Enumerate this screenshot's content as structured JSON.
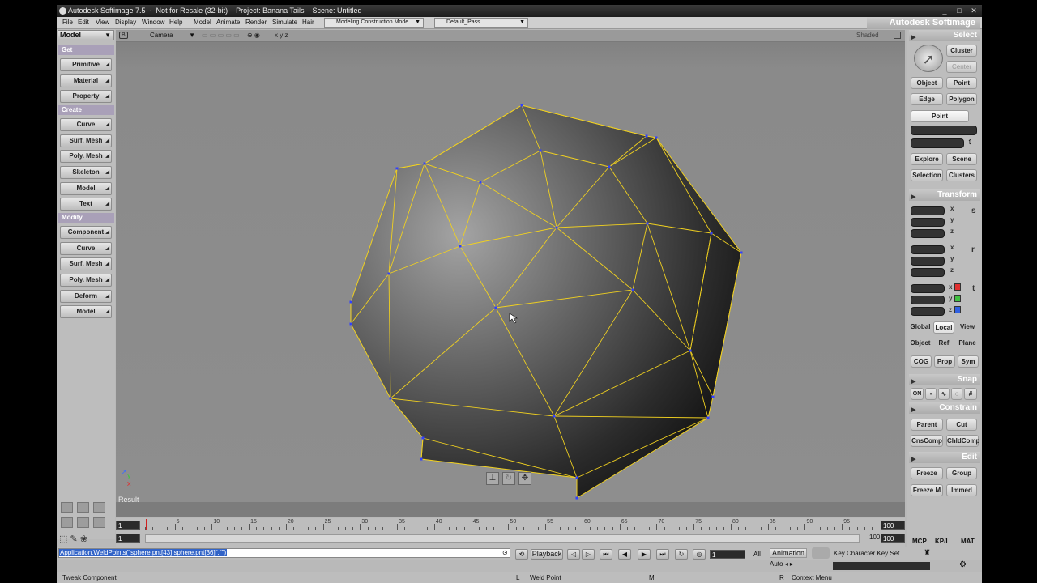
{
  "window": {
    "title": "Autodesk Softimage 7.5  -  Not for Resale (32-bit)    Project: Banana Tails    Scene: Untitled",
    "brand": "Autodesk Softimage",
    "controls": [
      "_",
      "□",
      "✕"
    ]
  },
  "menubar": {
    "items": [
      "File",
      "Edit",
      "View",
      "Display",
      "Window",
      "Help",
      "Model",
      "Animate",
      "Render",
      "Simulate",
      "Hair"
    ],
    "construction_mode": "Modeling Construction Mode",
    "render_pass": "Default_Pass"
  },
  "leftpanel": {
    "module": "Model",
    "sections": {
      "get": "Get",
      "create": "Create",
      "modify": "Modify"
    },
    "get_buttons": [
      "Primitive",
      "Material",
      "Property"
    ],
    "create_buttons": [
      "Curve",
      "Surf. Mesh",
      "Poly. Mesh",
      "Skeleton",
      "Model",
      "Text"
    ],
    "modify_buttons": [
      "Component",
      "Curve",
      "Surf. Mesh",
      "Poly. Mesh",
      "Deform",
      "Model"
    ]
  },
  "viewport": {
    "view_letter": "B",
    "camera": "Camera",
    "axes": "x  y  z",
    "display_mode": "Shaded",
    "result_label": "Result"
  },
  "timeline": {
    "start_frame": "1",
    "start_frame_2": "1",
    "end_frame": "100",
    "end_frame_2": "100",
    "end_label": "100",
    "current_frame": "1",
    "ticks": [
      "5",
      "10",
      "15",
      "20",
      "25",
      "30",
      "35",
      "40",
      "45",
      "50",
      "55",
      "60",
      "65",
      "70",
      "75",
      "80",
      "85",
      "90",
      "95"
    ]
  },
  "commandbar": {
    "command": "Application.WeldPoints(\"sphere.pnt[43];sphere.pnt[36]\",\"\")",
    "playback_label": "Playback",
    "frame_value": "1",
    "all_label": "All",
    "animation_label": "Animation",
    "auto_label": "Auto",
    "keyset_label": "Key Character Key Set"
  },
  "statusbar": {
    "left": "Tweak Component",
    "l_key": "L",
    "l_action": "Weld Point",
    "m_key": "M",
    "r_key": "R",
    "r_action": "Context Menu"
  },
  "rightpanel": {
    "select": {
      "title": "Select",
      "cluster": "Cluster",
      "center": "Center",
      "object": "Object",
      "point": "Point",
      "edge": "Edge",
      "polygon": "Polygon",
      "active_filter": "Point",
      "explore": "Explore",
      "scene": "Scene",
      "selection": "Selection",
      "clusters": "Clusters"
    },
    "transform": {
      "title": "Transform",
      "axes": [
        "x",
        "y",
        "z"
      ],
      "s": "s",
      "r": "r",
      "t": "t",
      "global": "Global",
      "local": "Local",
      "view": "View",
      "object": "Object",
      "ref": "Ref",
      "plane": "Plane",
      "cog": "COG",
      "prop": "Prop",
      "sym": "Sym"
    },
    "snap": {
      "title": "Snap",
      "on": "ON"
    },
    "constrain": {
      "title": "Constrain",
      "parent": "Parent",
      "cut": "Cut",
      "cnscomp": "CnsComp",
      "chldcomp": "ChldComp"
    },
    "edit": {
      "title": "Edit",
      "freeze": "Freeze",
      "group": "Group",
      "freeze_m": "Freeze M",
      "immed": "Immed"
    },
    "tabs": [
      "MCP",
      "KP/L",
      "MAT"
    ]
  },
  "colors": {
    "wire": "#f0d020",
    "vertex": "#3040ff",
    "section_header": "#a9a0b8",
    "selection": "#3264c8"
  }
}
